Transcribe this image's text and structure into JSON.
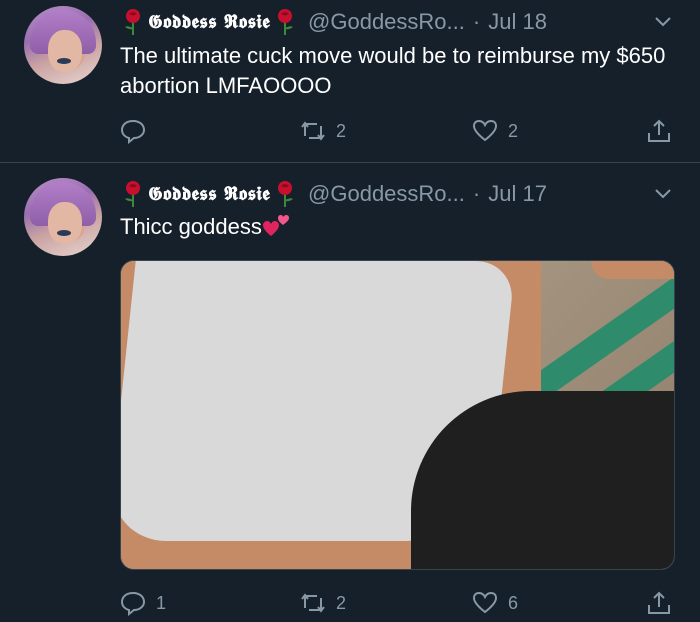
{
  "tweets": [
    {
      "display_name": "𝕲𝖔𝖉𝖉𝖊𝖘𝖘 𝕽𝖔𝖘𝖎𝖊",
      "handle": "@GoddessRo...",
      "separator": "·",
      "date": "Jul 18",
      "text": "The ultimate cuck move would be to reimburse my $650 abortion LMFAOOOO",
      "replies": "",
      "retweets": "2",
      "likes": "2"
    },
    {
      "display_name": "𝕲𝖔𝖉𝖉𝖊𝖘𝖘 𝕽𝖔𝖘𝖎𝖊",
      "handle": "@GoddessRo...",
      "separator": "·",
      "date": "Jul 17",
      "text": "Thicc goddess",
      "replies": "1",
      "retweets": "2",
      "likes": "6"
    }
  ],
  "colors": {
    "background": "#15202b",
    "secondary_text": "#8899a6",
    "divider": "#38444d"
  },
  "icons": [
    "rose-icon",
    "chevron-down-icon",
    "reply-icon",
    "retweet-icon",
    "like-icon",
    "share-icon",
    "two-hearts-emoji"
  ]
}
